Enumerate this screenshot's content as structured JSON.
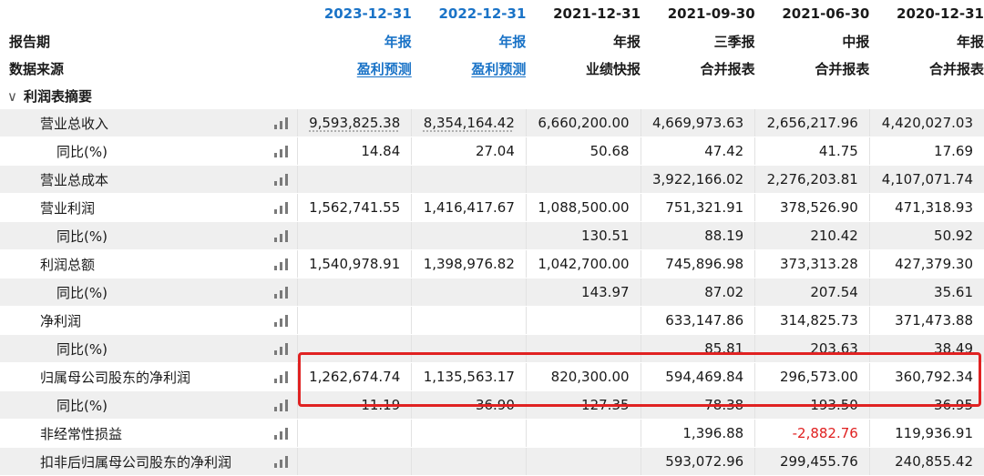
{
  "header": {
    "dates": [
      "2023-12-31",
      "2022-12-31",
      "2021-12-31",
      "2021-09-30",
      "2021-06-30",
      "2020-12-31"
    ],
    "report_period_label": "报告期",
    "report_types": [
      "年报",
      "年报",
      "年报",
      "三季报",
      "中报",
      "年报"
    ],
    "data_source_label": "数据来源",
    "sources": [
      "盈利预测",
      "盈利预测",
      "业绩快报",
      "合并报表",
      "合并报表",
      "合并报表"
    ]
  },
  "section": {
    "title": "利润表摘要"
  },
  "rows": [
    {
      "label": "营业总收入",
      "values": [
        "9,593,825.38",
        "8,354,164.42",
        "6,660,200.00",
        "4,669,973.63",
        "2,656,217.96",
        "4,420,027.03"
      ]
    },
    {
      "label": "同比(%)",
      "values": [
        "14.84",
        "27.04",
        "50.68",
        "47.42",
        "41.75",
        "17.69"
      ]
    },
    {
      "label": "营业总成本",
      "values": [
        "",
        "",
        "",
        "3,922,166.02",
        "2,276,203.81",
        "4,107,071.74"
      ]
    },
    {
      "label": "营业利润",
      "values": [
        "1,562,741.55",
        "1,416,417.67",
        "1,088,500.00",
        "751,321.91",
        "378,526.90",
        "471,318.93"
      ]
    },
    {
      "label": "同比(%)",
      "values": [
        "",
        "",
        "130.51",
        "88.19",
        "210.42",
        "50.92"
      ]
    },
    {
      "label": "利润总额",
      "values": [
        "1,540,978.91",
        "1,398,976.82",
        "1,042,700.00",
        "745,896.98",
        "373,313.28",
        "427,379.30"
      ]
    },
    {
      "label": "同比(%)",
      "values": [
        "",
        "",
        "143.97",
        "87.02",
        "207.54",
        "35.61"
      ]
    },
    {
      "label": "净利润",
      "values": [
        "",
        "",
        "",
        "633,147.86",
        "314,825.73",
        "371,473.88"
      ]
    },
    {
      "label": "同比(%)",
      "values": [
        "",
        "",
        "",
        "85.81",
        "203.63",
        "38.49"
      ]
    },
    {
      "label": "归属母公司股东的净利润",
      "values": [
        "1,262,674.74",
        "1,135,563.17",
        "820,300.00",
        "594,469.84",
        "296,573.00",
        "360,792.34"
      ]
    },
    {
      "label": "同比(%)",
      "values": [
        "11.19",
        "36.90",
        "127.35",
        "78.38",
        "193.50",
        "36.95"
      ]
    },
    {
      "label": "非经常性损益",
      "values": [
        "",
        "",
        "",
        "1,396.88",
        "-2,882.76",
        "119,936.91"
      ]
    },
    {
      "label": "扣非后归属母公司股东的净利润",
      "values": [
        "",
        "",
        "",
        "593,072.96",
        "299,455.76",
        "240,855.42"
      ]
    }
  ],
  "colors": {
    "forecast_blue": "#1a73c7",
    "negative_red": "#e02020",
    "highlight_border": "#e02222",
    "row_alt_bg": "#efefef"
  },
  "icons": {
    "chart": "bar-chart-icon",
    "collapse": "chevron-down-icon"
  }
}
